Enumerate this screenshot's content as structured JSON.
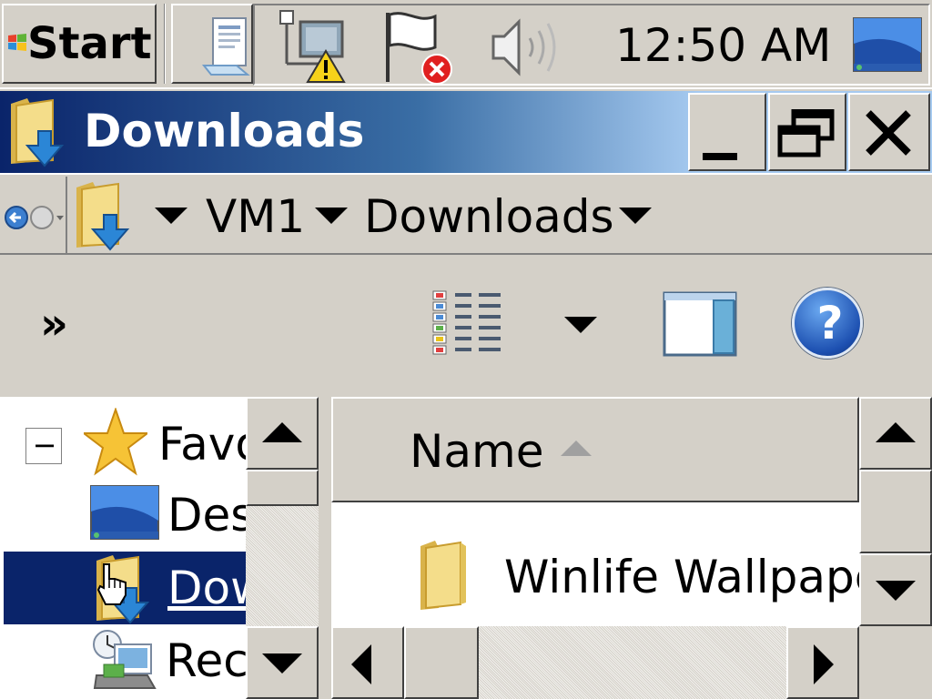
{
  "taskbar": {
    "start_label": "Start",
    "clock": "12:50 AM"
  },
  "window": {
    "title": "Downloads",
    "minimize_glyph": "_",
    "close_glyph": "✕"
  },
  "address": {
    "crumbs": [
      "VM1",
      "Downloads"
    ]
  },
  "toolbar": {
    "overflow_glyph": "»",
    "help_glyph": "?"
  },
  "nav_pane": {
    "expander_glyph": "−",
    "items": [
      {
        "label": "Favorites",
        "icon": "star-icon"
      },
      {
        "label": "Desktop",
        "icon": "desktop-icon"
      },
      {
        "label": "Downloads",
        "icon": "downloads-folder-icon",
        "selected": true
      },
      {
        "label": "Recent Places",
        "icon": "recent-places-icon"
      }
    ]
  },
  "file_list": {
    "column_name": "Name",
    "sort": "ascending",
    "files": [
      {
        "name": "Winlife Wallpapers",
        "icon": "folder-icon"
      }
    ]
  },
  "colors": {
    "titlebar_start": "#0a246a",
    "titlebar_end": "#a6caf0",
    "selection": "#0a246a",
    "face": "#d4d0c8"
  }
}
